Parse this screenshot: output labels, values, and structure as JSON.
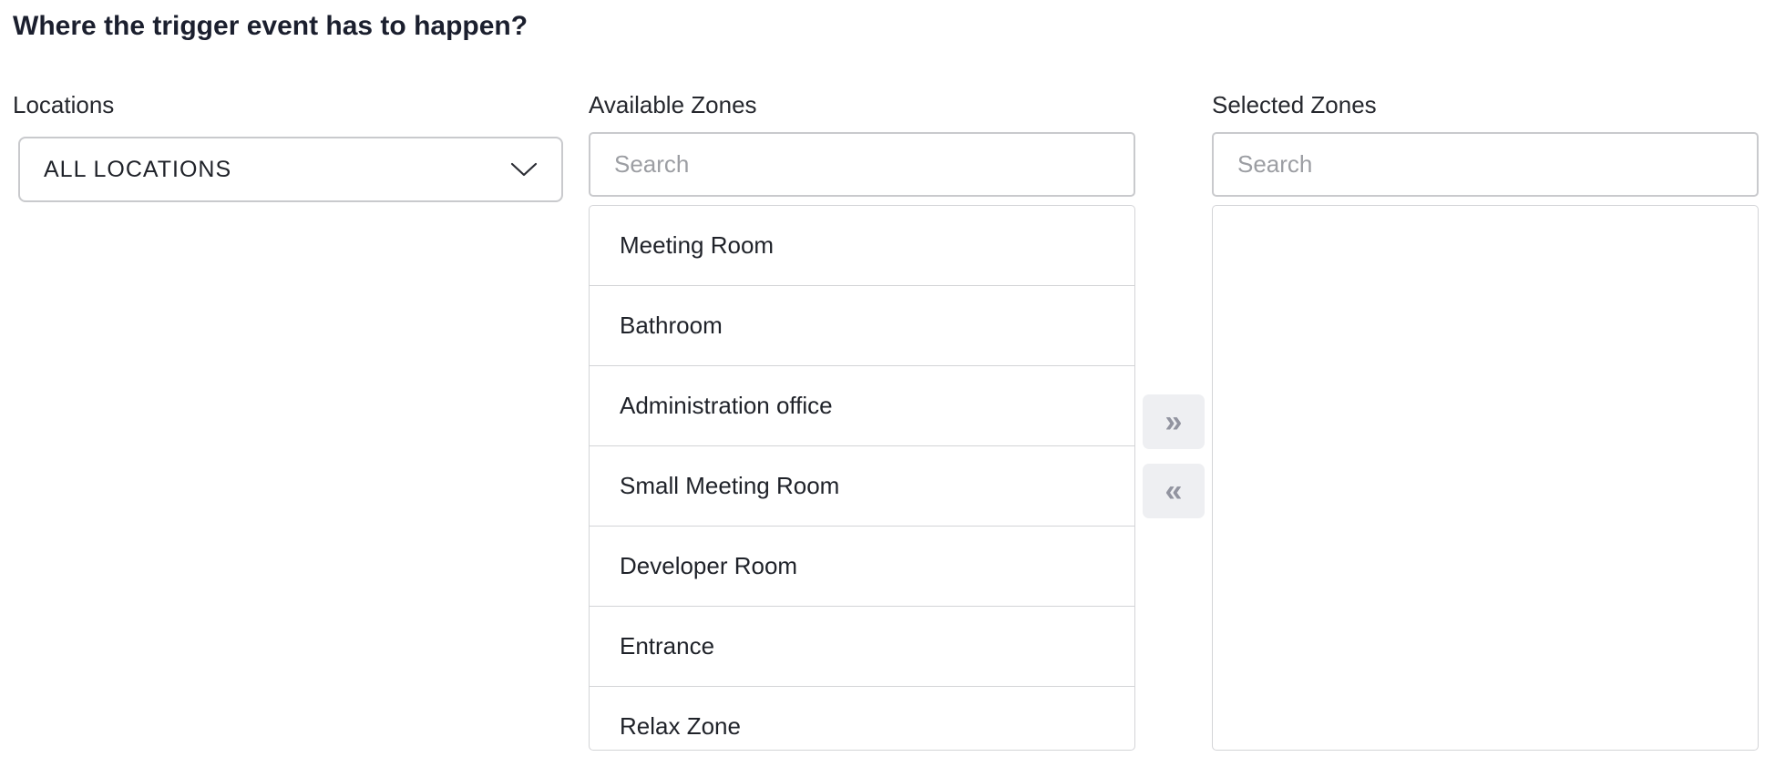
{
  "heading": "Where the trigger event has to happen?",
  "locations": {
    "label": "Locations",
    "selected": "ALL LOCATIONS",
    "icon": "chevron-down-icon"
  },
  "available_zones": {
    "label": "Available Zones",
    "search_placeholder": "Search",
    "items": [
      "Meeting Room",
      "Bathroom",
      "Administration office",
      "Small Meeting Room",
      "Developer Room",
      "Entrance",
      "Relax Zone"
    ]
  },
  "selected_zones": {
    "label": "Selected Zones",
    "search_placeholder": "Search",
    "items": []
  },
  "transfer_buttons": {
    "move_right_label": "»",
    "move_left_label": "«"
  }
}
